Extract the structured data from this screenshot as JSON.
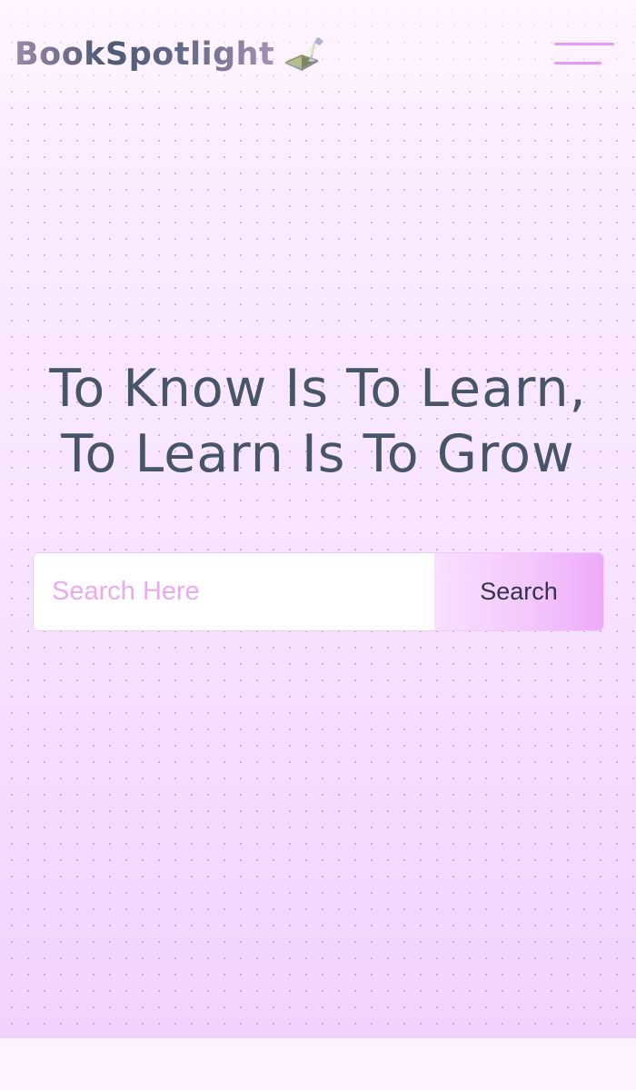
{
  "brand": {
    "name": "BookSpotlight",
    "icon": "reading-lamp-book-icon"
  },
  "nav": {
    "menu_icon": "hamburger-menu-icon"
  },
  "hero": {
    "headline_line1": "To Know Is To Learn,",
    "headline_line2": "To Learn Is To Grow"
  },
  "search": {
    "placeholder": "Search Here",
    "value": "",
    "button_label": "Search"
  },
  "colors": {
    "heading": "#475569",
    "accent": "#eea8f3",
    "menu_bars": "#e59af5",
    "background": "#f8e2ff"
  }
}
